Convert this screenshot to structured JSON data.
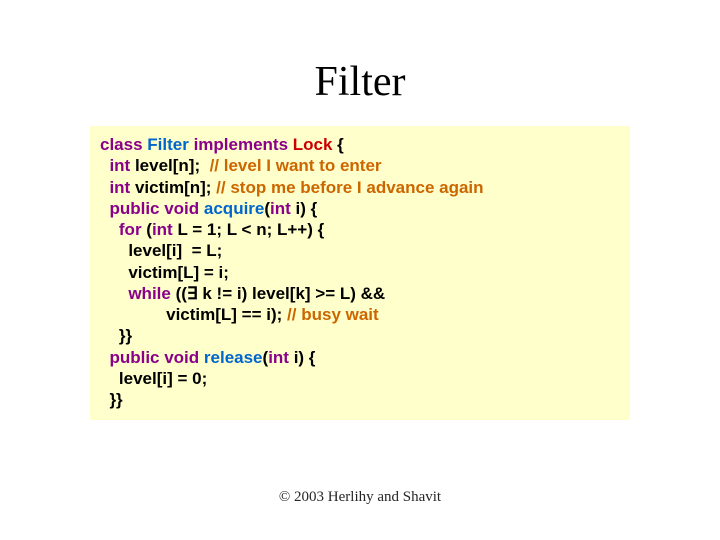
{
  "slide": {
    "title": "Filter",
    "copyright": "© 2003 Herlihy and Shavit"
  },
  "code": {
    "l01_kw1": "class",
    "l01_name": " Filter ",
    "l01_kw2": "implements",
    "l01_type": " Lock ",
    "l01_brace": "{",
    "l02_kw": "  int",
    "l02_rest": " level[n];  ",
    "l02_comment": "// level I want to enter",
    "l03_kw": "  int",
    "l03_rest": " victim[n]; ",
    "l03_comment": "// stop me before I advance again",
    "l04_kw1": "  public void",
    "l04_name": " acquire",
    "l04_sig_open": "(",
    "l04_kw2": "int",
    "l04_sig_rest": " i) {",
    "l05_kw1": "    for",
    "l05_open": " (",
    "l05_kw2": "int",
    "l05_rest": " L = 1; L < n; L++) {",
    "l06": "      level[i]  = L;",
    "l07": "      victim[L] = i;",
    "l08_kw": "      while",
    "l08_rest": " ((∃ k != i) level[k] >= L) &&",
    "l09_rest": "              victim[L] == i); ",
    "l09_comment": "// busy wait",
    "l10": "    }}",
    "l11_kw1": "  public void",
    "l11_name": " release",
    "l11_sig_open": "(",
    "l11_kw2": "int",
    "l11_sig_rest": " i) {",
    "l12": "    level[i] = 0;",
    "l13": "  }}"
  }
}
